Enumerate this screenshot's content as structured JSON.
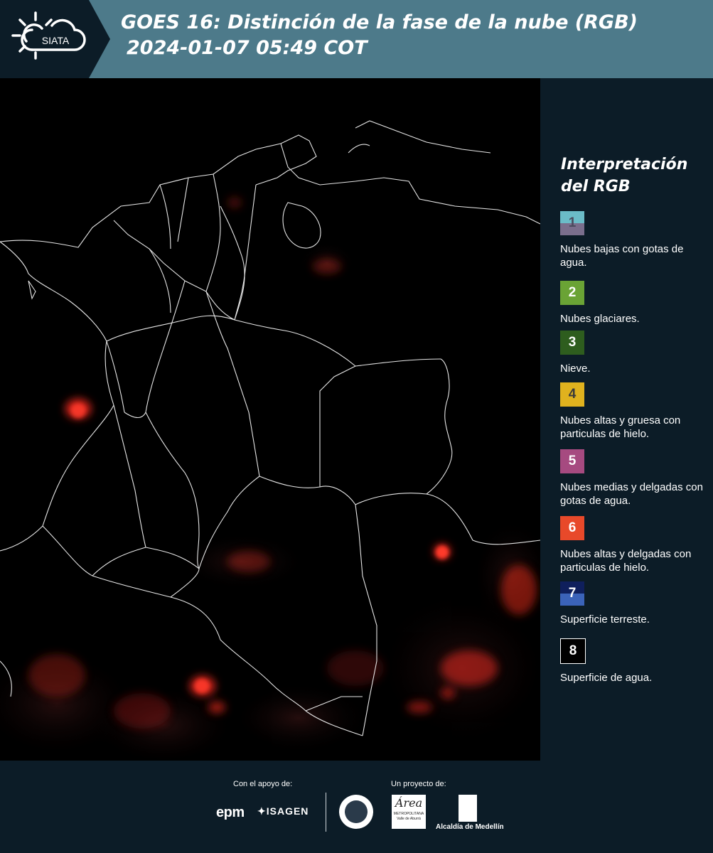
{
  "header": {
    "logo_text": "SIATA",
    "title_line1": "GOES 16: Distinción de la fase de la nube (RGB)",
    "title_line2": "2024-01-07 05:49 COT"
  },
  "legend": {
    "title_line1": "Interpretación",
    "title_line2": "del RGB",
    "items": [
      {
        "num": "1",
        "label": "Nubes bajas con gotas de agua.",
        "color_top": "#6bbcc8",
        "color_bottom": "#7a6e8c",
        "num_color": "#4b4b5e"
      },
      {
        "num": "2",
        "label": "Nubes glaciares.",
        "color_top": "#6aa335",
        "color_bottom": "#6aa335",
        "num_color": "#ffffff"
      },
      {
        "num": "3",
        "label": "Nieve.",
        "color_top": "#2e5d1e",
        "color_bottom": "#2e5d1e",
        "num_color": "#ffffff"
      },
      {
        "num": "4",
        "label": "Nubes altas y gruesa con particulas de hielo.",
        "color_top": "#e0b21e",
        "color_bottom": "#e0b21e",
        "num_color": "#3a3a3a"
      },
      {
        "num": "5",
        "label": "Nubes medias y delgadas con gotas de agua.",
        "color_top": "#a64a80",
        "color_bottom": "#a64a80",
        "num_color": "#ffffff"
      },
      {
        "num": "6",
        "label": "Nubes altas y delgadas con particulas de hielo.",
        "color_top": "#e8492a",
        "color_bottom": "#e8492a",
        "num_color": "#ffffff"
      },
      {
        "num": "7",
        "label": "Superficie terreste.",
        "color_top": "#0f1f5c",
        "color_bottom": "#3b63b9",
        "num_color": "#ffffff"
      },
      {
        "num": "8",
        "label": "Superficie de agua.",
        "color_top": "#000000",
        "color_bottom": "#000000",
        "num_color": "#ffffff"
      }
    ]
  },
  "footer": {
    "support_label": "Con el apoyo de:",
    "project_label": "Un proyecto de:",
    "epm": "epm",
    "isagen": "ISAGEN",
    "area_script": "Área",
    "area_line1": "METROPOLITANA",
    "area_line2": "Valle de Aburrá",
    "alcaldia": "Alcaldía de Medellín"
  }
}
